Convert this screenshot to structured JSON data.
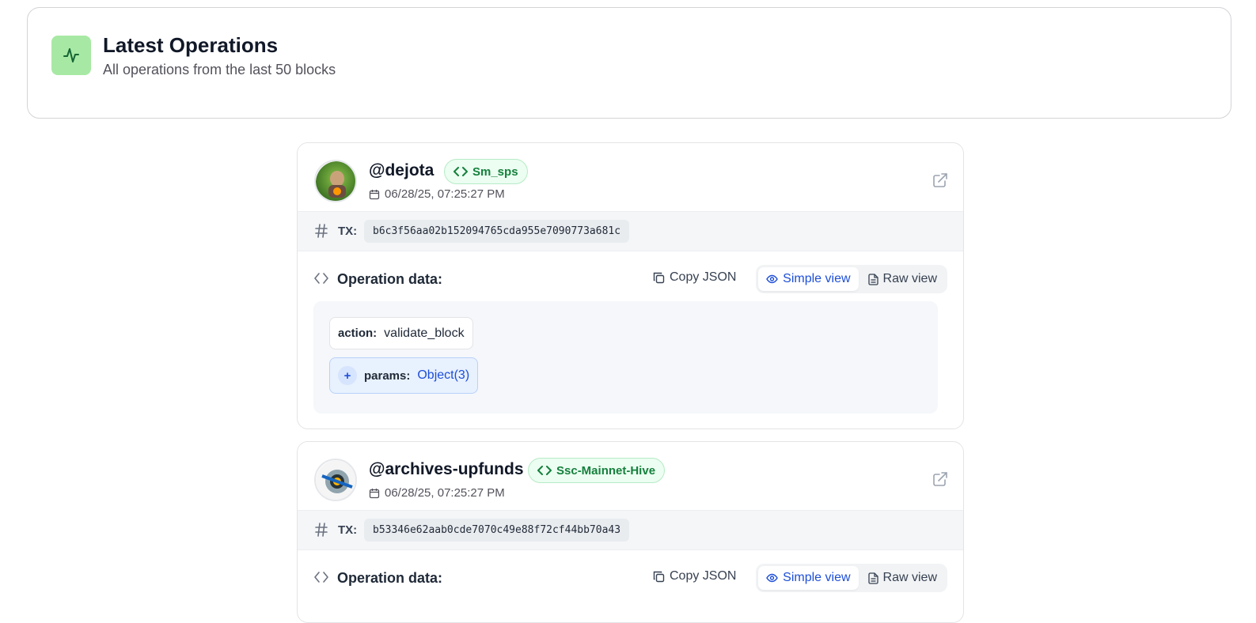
{
  "header": {
    "title": "Latest Operations",
    "subtitle": "All operations from the last 50 blocks",
    "icon": "activity-pulse-icon",
    "accent": "#a7e9a4"
  },
  "operations": [
    {
      "user": "@dejota",
      "badge": "Sm_sps",
      "time": "06/28/25, 07:25:27 PM",
      "tx_label": "TX:",
      "tx": "b6c3f56aa02b152094765cda955e7090773a681c",
      "opdata_label": "Operation data:",
      "copy_label": "Copy JSON",
      "simple_view": "Simple view",
      "raw_view": "Raw view",
      "fields": [
        {
          "key": "action:",
          "value": "validate_block"
        },
        {
          "key": "params:",
          "value": "Object(3)",
          "expandable": "+"
        }
      ]
    },
    {
      "user": "@archives-upfunds",
      "badge": "Ssc-Mainnet-Hive",
      "time": "06/28/25, 07:25:27 PM",
      "tx_label": "TX:",
      "tx": "b53346e62aab0cde7070c49e88f72cf44bb70a43",
      "opdata_label": "Operation data:",
      "copy_label": "Copy JSON",
      "simple_view": "Simple view",
      "raw_view": "Raw view"
    }
  ],
  "colors": {
    "badge_text": "#15803d",
    "active_view": "#1d4ed8"
  }
}
